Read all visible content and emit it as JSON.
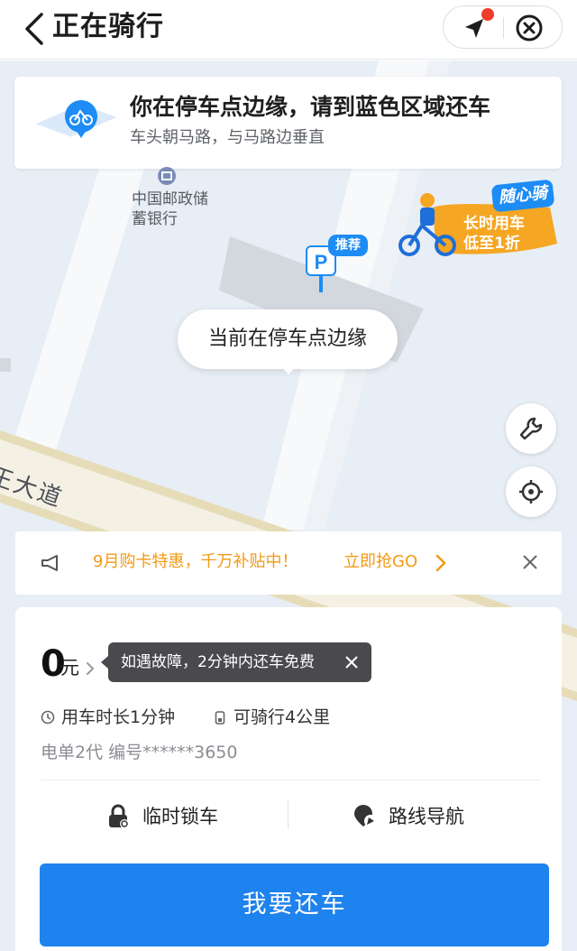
{
  "header": {
    "title": "正在骑行",
    "back_icon": "chevron-left-icon",
    "location_icon": "navigation-arrow-icon",
    "close_icon": "close-circle-icon",
    "notification_dot_color": "#ee3b2a"
  },
  "map": {
    "notice": {
      "title": "你在停车点边缘，请到蓝色区域还车",
      "subtitle": "车头朝马路，与马路边垂直"
    },
    "poi": {
      "name": "中国邮政储蓄银行"
    },
    "promo_art": {
      "badge": "随心骑",
      "line1": "长时用车",
      "line2": "低至1折"
    },
    "parking": {
      "tag": "推荐",
      "letter": "P"
    },
    "bubble": "当前在停车点边缘",
    "road_label": "王大道",
    "tool_buttons": [
      "wrench-icon",
      "locate-icon"
    ]
  },
  "banner": {
    "text": "9月购卡特惠，千万补贴中！",
    "link": "立即抢GO",
    "color": "#f29a16"
  },
  "ride": {
    "price_value": "0",
    "price_unit": "元",
    "tip": "如遇故障，2分钟内还车免费",
    "duration": "用车时长1分钟",
    "range": "可骑行4公里",
    "model": "电单2代  编号******3650",
    "actions": {
      "lock": "临时锁车",
      "route": "路线导航"
    },
    "return_button": "我要还车",
    "accent_color": "#1e83ee"
  }
}
